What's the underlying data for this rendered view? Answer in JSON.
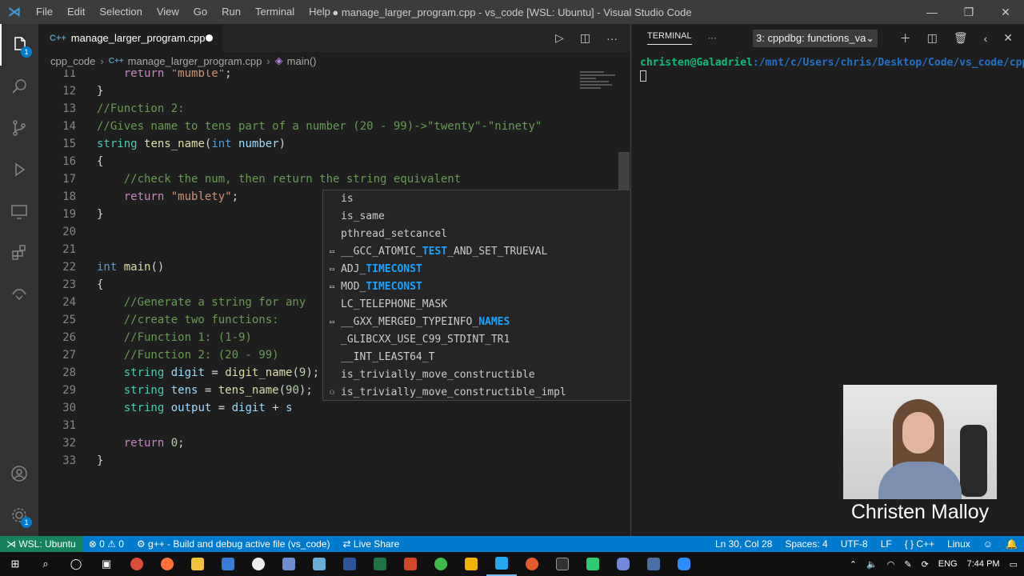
{
  "window": {
    "title": "● manage_larger_program.cpp - vs_code [WSL: Ubuntu] - Visual Studio Code",
    "menu": [
      "File",
      "Edit",
      "Selection",
      "View",
      "Go",
      "Run",
      "Terminal",
      "Help"
    ]
  },
  "activity_bar": {
    "explorer_badge": "1",
    "settings_badge": "1"
  },
  "editor": {
    "tab_label": "manage_larger_program.cpp",
    "tab_icon": "C++",
    "breadcrumb": {
      "folder": "cpp_code",
      "file": "manage_larger_program.cpp",
      "symbol": "main()"
    },
    "lines": [
      {
        "n": "11",
        "segments": [
          {
            "t": "    "
          },
          {
            "t": "return",
            "c": "ctl"
          },
          {
            "t": " "
          },
          {
            "t": "\"mumble\"",
            "c": "str"
          },
          {
            "t": ";"
          }
        ]
      },
      {
        "n": "12",
        "segments": [
          {
            "t": "}"
          }
        ]
      },
      {
        "n": "13",
        "segments": [
          {
            "t": "//Function 2:",
            "c": "cm"
          }
        ]
      },
      {
        "n": "14",
        "segments": [
          {
            "t": "//Gives name to tens part of a number (20 - 99)->\"twenty\"-\"ninety\"",
            "c": "cm"
          }
        ]
      },
      {
        "n": "15",
        "segments": [
          {
            "t": "string",
            "c": "ty"
          },
          {
            "t": " "
          },
          {
            "t": "tens_name",
            "c": "fnc"
          },
          {
            "t": "("
          },
          {
            "t": "int",
            "c": "kw"
          },
          {
            "t": " "
          },
          {
            "t": "number",
            "c": "var"
          },
          {
            "t": ")"
          }
        ]
      },
      {
        "n": "16",
        "segments": [
          {
            "t": "{"
          }
        ]
      },
      {
        "n": "17",
        "segments": [
          {
            "t": "    "
          },
          {
            "t": "//check the num, then return the string equivalent",
            "c": "cm"
          }
        ]
      },
      {
        "n": "18",
        "segments": [
          {
            "t": "    "
          },
          {
            "t": "return",
            "c": "ctl"
          },
          {
            "t": " "
          },
          {
            "t": "\"mublety\"",
            "c": "str"
          },
          {
            "t": ";"
          }
        ]
      },
      {
        "n": "19",
        "segments": [
          {
            "t": "}"
          }
        ]
      },
      {
        "n": "20",
        "segments": []
      },
      {
        "n": "21",
        "segments": []
      },
      {
        "n": "22",
        "segments": [
          {
            "t": "int",
            "c": "kw"
          },
          {
            "t": " "
          },
          {
            "t": "main",
            "c": "fnc"
          },
          {
            "t": "()"
          }
        ]
      },
      {
        "n": "23",
        "segments": [
          {
            "t": "{"
          }
        ]
      },
      {
        "n": "24",
        "segments": [
          {
            "t": "    "
          },
          {
            "t": "//Generate a string for any",
            "c": "cm"
          }
        ]
      },
      {
        "n": "25",
        "segments": [
          {
            "t": "    "
          },
          {
            "t": "//create two functions:",
            "c": "cm"
          }
        ]
      },
      {
        "n": "26",
        "segments": [
          {
            "t": "    "
          },
          {
            "t": "//Function 1: (1-9)",
            "c": "cm"
          }
        ]
      },
      {
        "n": "27",
        "segments": [
          {
            "t": "    "
          },
          {
            "t": "//Function 2: (20 - 99)",
            "c": "cm"
          }
        ]
      },
      {
        "n": "28",
        "segments": [
          {
            "t": "    "
          },
          {
            "t": "string",
            "c": "ty"
          },
          {
            "t": " "
          },
          {
            "t": "digit",
            "c": "var"
          },
          {
            "t": " = "
          },
          {
            "t": "digit_name",
            "c": "fnc"
          },
          {
            "t": "("
          },
          {
            "t": "9",
            "c": "num"
          },
          {
            "t": ");"
          }
        ]
      },
      {
        "n": "29",
        "segments": [
          {
            "t": "    "
          },
          {
            "t": "string",
            "c": "ty"
          },
          {
            "t": " "
          },
          {
            "t": "tens",
            "c": "var"
          },
          {
            "t": " = "
          },
          {
            "t": "tens_name",
            "c": "fnc"
          },
          {
            "t": "("
          },
          {
            "t": "90",
            "c": "num"
          },
          {
            "t": ");"
          }
        ]
      },
      {
        "n": "30",
        "segments": [
          {
            "t": "    "
          },
          {
            "t": "string",
            "c": "ty"
          },
          {
            "t": " "
          },
          {
            "t": "output",
            "c": "var"
          },
          {
            "t": " = "
          },
          {
            "t": "digit",
            "c": "var"
          },
          {
            "t": " + "
          },
          {
            "t": "s",
            "c": "var"
          }
        ]
      },
      {
        "n": "31",
        "segments": []
      },
      {
        "n": "32",
        "segments": [
          {
            "t": "    "
          },
          {
            "t": "return",
            "c": "ctl"
          },
          {
            "t": " "
          },
          {
            "t": "0",
            "c": "num"
          },
          {
            "t": ";"
          }
        ]
      },
      {
        "n": "33",
        "segments": [
          {
            "t": "}"
          }
        ]
      }
    ]
  },
  "suggest": {
    "items": [
      {
        "icon": "",
        "pre": "",
        "hl": "",
        "post": "is"
      },
      {
        "icon": "",
        "pre": "",
        "hl": "",
        "post": "is_same"
      },
      {
        "icon": "",
        "pre": "",
        "hl": "",
        "post": "pthread_setcancel"
      },
      {
        "icon": "▭",
        "pre": "__GCC_ATOMIC_",
        "hl": "TEST",
        "post": "_AND_SET_TRUEVAL"
      },
      {
        "icon": "▭",
        "pre": "ADJ_",
        "hl": "TIMECONST",
        "post": ""
      },
      {
        "icon": "▭",
        "pre": "MOD_",
        "hl": "TIMECONST",
        "post": ""
      },
      {
        "icon": "",
        "pre": "LC_TELEPHONE_MASK",
        "hl": "",
        "post": ""
      },
      {
        "icon": "▭",
        "pre": "__GXX_MERGED_TYPEINFO_",
        "hl": "NAMES",
        "post": ""
      },
      {
        "icon": "",
        "pre": "_GLIBCXX_USE_",
        "hl": "",
        "post": "C99_STDINT_TR1"
      },
      {
        "icon": "",
        "pre": "__INT_LEAST64_T",
        "hl": "",
        "post": ""
      },
      {
        "icon": "",
        "pre": "is_trivially_move_constructible",
        "hl": "",
        "post": ""
      },
      {
        "icon": "⚇",
        "pre": "is_trivially_move_constructible_impl",
        "hl": "",
        "post": ""
      }
    ]
  },
  "terminal": {
    "tab_title": "TERMINAL",
    "selected_shell": "3: cppdbg: functions_va",
    "prompt_user": "christen@Galadriel",
    "prompt_path": ":/mnt/c/Users/chris/Desktop/Code/vs_code/cpp_code",
    "prompt_symbol": "$"
  },
  "webcam": {
    "name": "Christen Malloy"
  },
  "statusbar": {
    "remote": "WSL: Ubuntu",
    "errors": "0",
    "warnings": "0",
    "task": "g++ - Build and debug active file (vs_code)",
    "live_share": "Live Share",
    "position": "Ln 30, Col 28",
    "spaces": "Spaces: 4",
    "encoding": "UTF-8",
    "eol": "LF",
    "language": "C++",
    "os": "Linux"
  },
  "taskbar": {
    "lang": "ENG",
    "time": "7:44 PM"
  },
  "colors": {
    "statusbar": "#007acc",
    "remote": "#16825d",
    "editor_bg": "#1e1e1e"
  }
}
